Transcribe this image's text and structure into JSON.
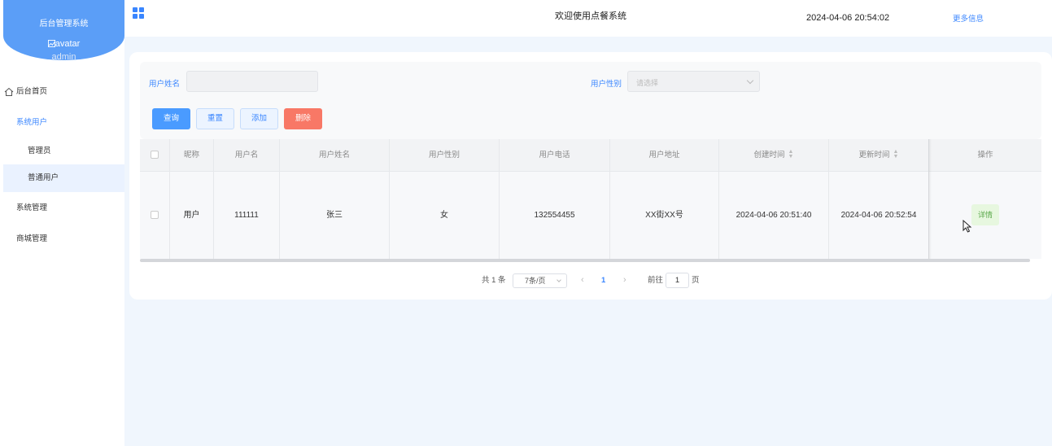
{
  "sidebar": {
    "title": "后台管理系统",
    "avatar_alt": "avatar",
    "username": "admin",
    "items": [
      {
        "label": "后台首页"
      },
      {
        "label": "系统用户"
      },
      {
        "label": "管理员"
      },
      {
        "label": "普通用户"
      },
      {
        "label": "系统管理"
      },
      {
        "label": "商城管理"
      }
    ]
  },
  "header": {
    "welcome": "欢迎使用点餐系统",
    "datetime": "2024-04-06 20:54:02",
    "more_info": "更多信息"
  },
  "filters": {
    "name_label": "用户姓名",
    "name_value": "",
    "gender_label": "用户性别",
    "gender_placeholder": "请选择"
  },
  "buttons": {
    "search": "查询",
    "reset": "重置",
    "add": "添加",
    "delete": "删除"
  },
  "table": {
    "columns": [
      "昵称",
      "用户名",
      "用户姓名",
      "用户性别",
      "用户电话",
      "用户地址",
      "创建时间",
      "更新时间",
      "操作"
    ],
    "rows": [
      {
        "nickname": "用户",
        "username": "111111",
        "realname": "张三",
        "gender": "女",
        "phone": "132554455",
        "address": "XX街XX号",
        "created": "2024-04-06 20:51:40",
        "updated": "2024-04-06 20:52:54",
        "action": "详情"
      }
    ]
  },
  "pagination": {
    "total": "共 1 条",
    "page_size": "7条/页",
    "current": "1",
    "goto_label": "前往",
    "goto_value": "1",
    "page_suffix": "页"
  },
  "colors": {
    "accent": "#3a86ff",
    "sidebar_header": "#5b9ef7",
    "danger": "#f87866",
    "main_bg": "#f0f6fd"
  }
}
